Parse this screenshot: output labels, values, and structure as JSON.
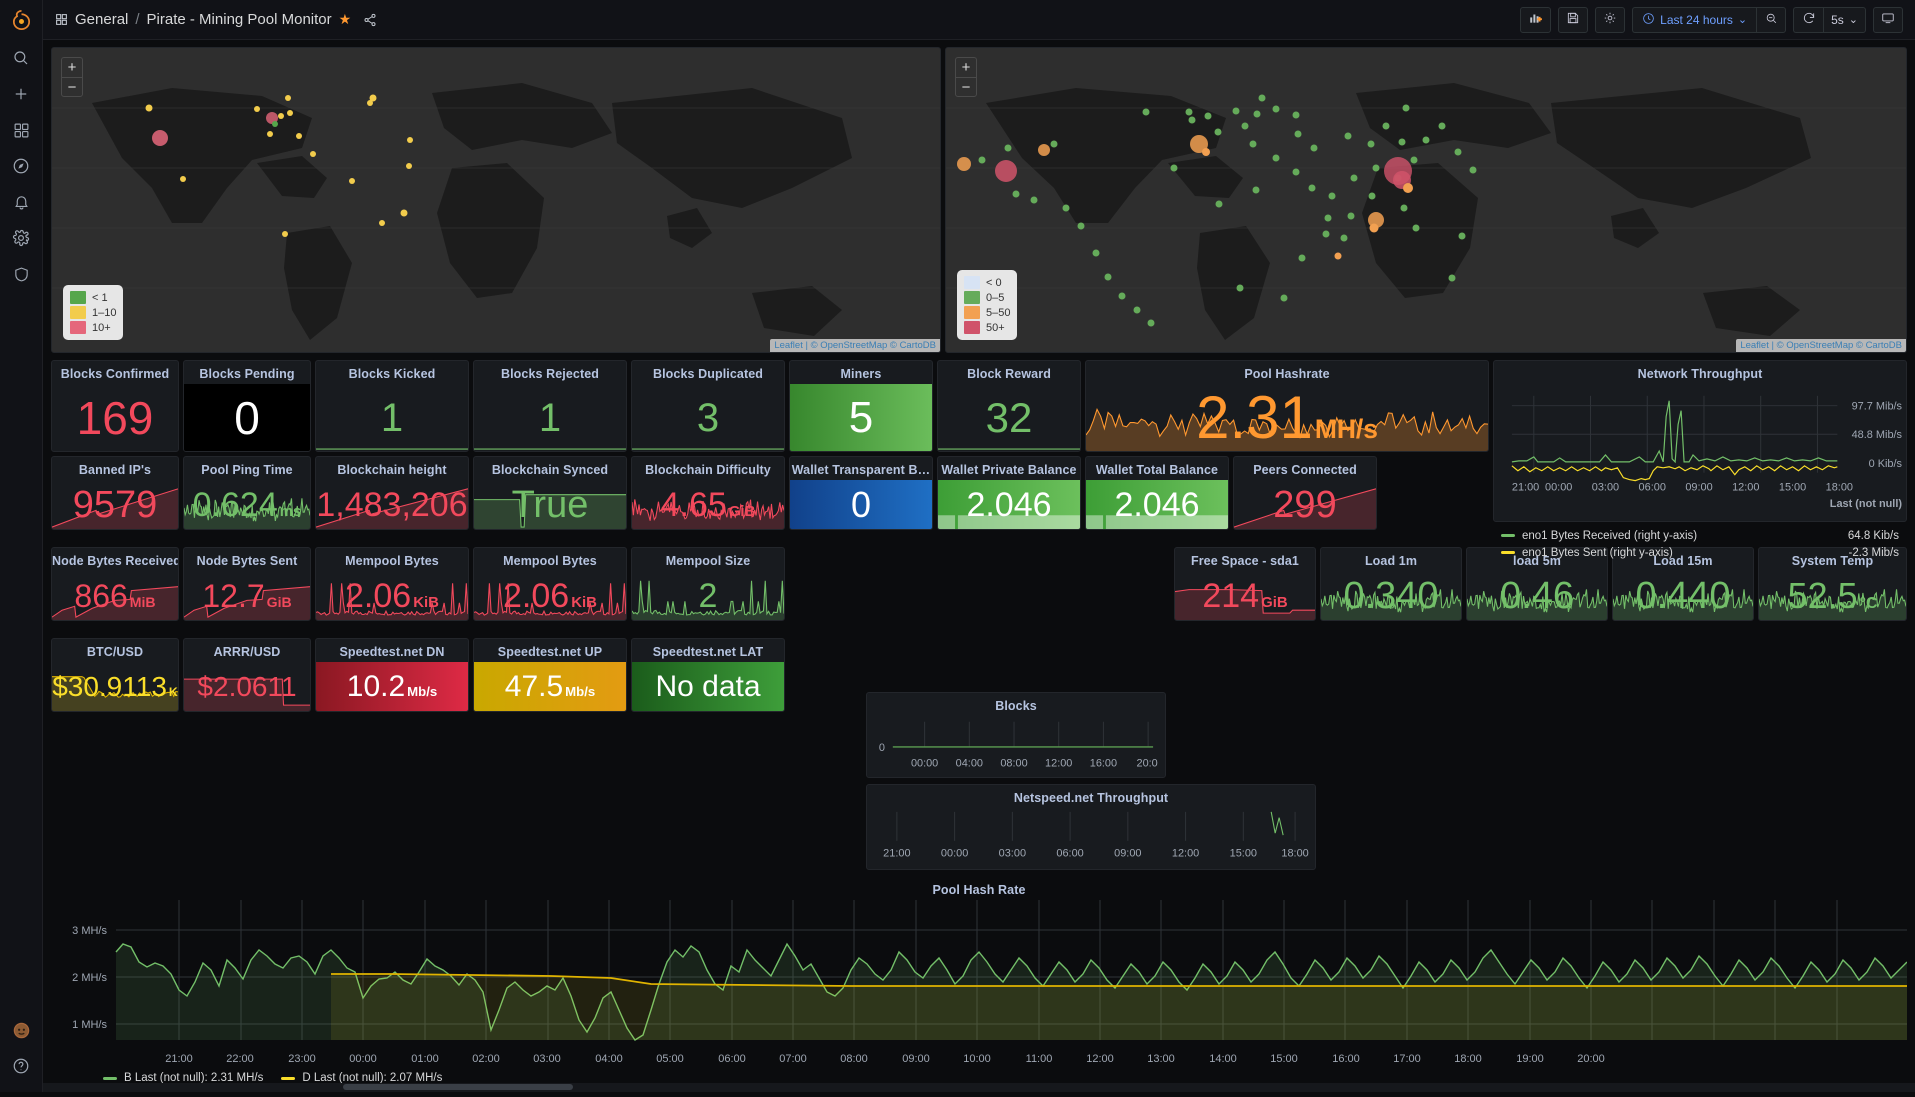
{
  "app": {
    "logo": "grafana-logo"
  },
  "sidebar": {
    "items": [
      {
        "name": "search-icon",
        "label": "Search"
      },
      {
        "name": "plus-icon",
        "label": "Create"
      },
      {
        "name": "dashboards-icon",
        "label": "Dashboards"
      },
      {
        "name": "explore-icon",
        "label": "Explore"
      },
      {
        "name": "bell-icon",
        "label": "Alerting"
      },
      {
        "name": "gear-icon",
        "label": "Configuration"
      },
      {
        "name": "shield-icon",
        "label": "Server Admin"
      }
    ],
    "bottom": [
      {
        "name": "user-avatar-icon",
        "label": "Profile"
      },
      {
        "name": "help-icon",
        "label": "Help"
      }
    ]
  },
  "header": {
    "folder": "General",
    "separator": "/",
    "title": "Pirate - Mining Pool Monitor",
    "star_icon": "star-icon",
    "share_icon": "share-icon",
    "toolbar": {
      "add_panel": "add-panel-icon",
      "save": "save-icon",
      "settings": "settings-icon",
      "time_range": "Last 24 hours",
      "time_icon": "clock-icon",
      "chevron": "⌄",
      "zoom_out": "zoom-out-icon",
      "refresh": "refresh-icon",
      "refresh_interval": "5s",
      "tv_mode": "tv-icon"
    }
  },
  "maps": {
    "left": {
      "title": "",
      "legend": [
        {
          "color": "#56a64b",
          "label": "< 1"
        },
        {
          "color": "#f2cc4c",
          "label": "1–10"
        },
        {
          "color": "#e5677b",
          "label": "10+"
        }
      ],
      "attribution": "Leaflet | © OpenStreetMap © CartoDB",
      "zoom_in": "+",
      "zoom_out": "−"
    },
    "right": {
      "title": "",
      "legend": [
        {
          "color": "#d7e3f4",
          "label": "< 0"
        },
        {
          "color": "#65ab5a",
          "label": "0–5"
        },
        {
          "color": "#f2a051",
          "label": "5–50"
        },
        {
          "color": "#d0536a",
          "label": "50+"
        }
      ],
      "attribution": "Leaflet | © OpenStreetMap © CartoDB",
      "zoom_in": "+",
      "zoom_out": "−"
    }
  },
  "stats": [
    {
      "id": "blocks-confirmed",
      "title": "Blocks Confirmed",
      "value": "169",
      "unit": "",
      "color": "#f2495c",
      "mode": "value",
      "spark": "up-red"
    },
    {
      "id": "blocks-pending",
      "title": "Blocks Pending",
      "value": "0",
      "unit": "",
      "color": "#ffffff",
      "mode": "bg-black",
      "spark": "none"
    },
    {
      "id": "blocks-kicked",
      "title": "Blocks Kicked",
      "value": "1",
      "unit": "",
      "color": "#73bf69",
      "mode": "value",
      "spark": "flat-green"
    },
    {
      "id": "blocks-rejected",
      "title": "Blocks Rejected",
      "value": "1",
      "unit": "",
      "color": "#73bf69",
      "mode": "value",
      "spark": "flat-green"
    },
    {
      "id": "blocks-duplicated",
      "title": "Blocks Duplicated",
      "value": "3",
      "unit": "",
      "color": "#73bf69",
      "mode": "value",
      "spark": "flat-green"
    },
    {
      "id": "miners",
      "title": "Miners",
      "value": "5",
      "unit": "",
      "color": "#ffffff",
      "mode": "bg-green",
      "spark": "none"
    },
    {
      "id": "block-reward",
      "title": "Block Reward",
      "value": "32",
      "unit": "",
      "color": "#73bf69",
      "mode": "value",
      "spark": "flat-green"
    },
    {
      "id": "pool-hashrate",
      "title": "Pool Hashrate",
      "value": "2.31",
      "unit": "MH/s",
      "color": "#ff9830",
      "mode": "value",
      "spark": "noisy-orange"
    },
    {
      "id": "banned-ips",
      "title": "Banned IP's",
      "value": "9579",
      "unit": "",
      "color": "#f2495c",
      "mode": "value",
      "spark": "ramp-red"
    },
    {
      "id": "pool-ping-time",
      "title": "Pool Ping Time",
      "value": "0.624",
      "unit": "ms",
      "color": "#73bf69",
      "mode": "value",
      "spark": "noisy-green"
    },
    {
      "id": "blockchain-height",
      "title": "Blockchain height",
      "value": "1,483,206",
      "unit": "",
      "color": "#f2495c",
      "mode": "value",
      "spark": "ramp-red"
    },
    {
      "id": "blockchain-synced",
      "title": "Blockchain Synced",
      "value": "True",
      "unit": "",
      "color": "#73bf69",
      "mode": "value",
      "spark": "step-green"
    },
    {
      "id": "blockchain-difficulty",
      "title": "Blockchain Difficulty",
      "value": "4.65",
      "unit": "GiB",
      "color": "#f2495c",
      "mode": "value",
      "spark": "noisy-red"
    },
    {
      "id": "wallet-transparent-balance",
      "title": "Wallet Transparent B…",
      "value": "0",
      "unit": "",
      "color": "#ffffff",
      "mode": "bg-blue",
      "spark": "none"
    },
    {
      "id": "wallet-private-balance",
      "title": "Wallet Private Balance",
      "value": "2.046",
      "unit": "",
      "color": "#ffffff",
      "mode": "bg-green2",
      "spark": "bars"
    },
    {
      "id": "wallet-total-balance",
      "title": "Wallet Total Balance",
      "value": "2.046",
      "unit": "",
      "color": "#ffffff",
      "mode": "bg-green2",
      "spark": "bars"
    },
    {
      "id": "peers-connected",
      "title": "Peers Connected",
      "value": "299",
      "unit": "",
      "color": "#f2495c",
      "mode": "value",
      "spark": "ramp-red"
    },
    {
      "id": "node-bytes-received",
      "title": "Node Bytes Received",
      "value": "866",
      "unit": "MiB",
      "color": "#f2495c",
      "mode": "value",
      "spark": "stair-red"
    },
    {
      "id": "node-bytes-sent",
      "title": "Node Bytes Sent",
      "value": "12.7",
      "unit": "GiB",
      "color": "#f2495c",
      "mode": "value",
      "spark": "stair-red"
    },
    {
      "id": "mempool-bytes-1",
      "title": "Mempool Bytes",
      "value": "2.06",
      "unit": "KiB",
      "color": "#f2495c",
      "mode": "value",
      "spark": "spike-red"
    },
    {
      "id": "mempool-bytes-2",
      "title": "Mempool Bytes",
      "value": "2.06",
      "unit": "KiB",
      "color": "#f2495c",
      "mode": "value",
      "spark": "spike-red"
    },
    {
      "id": "mempool-size",
      "title": "Mempool Size",
      "value": "2",
      "unit": "",
      "color": "#73bf69",
      "mode": "value",
      "spark": "spike-green"
    },
    {
      "id": "free-space-sda1",
      "title": "Free Space - sda1",
      "value": "214",
      "unit": "GiB",
      "color": "#f2495c",
      "mode": "value",
      "spark": "drop-red"
    },
    {
      "id": "load-1m",
      "title": "Load 1m",
      "value": "0.340",
      "unit": "",
      "color": "#73bf69",
      "mode": "value",
      "spark": "noisy-green"
    },
    {
      "id": "load-5m",
      "title": "load 5m",
      "value": "0.46",
      "unit": "",
      "color": "#73bf69",
      "mode": "value",
      "spark": "noisy-green"
    },
    {
      "id": "load-15m",
      "title": "Load 15m",
      "value": "0.440",
      "unit": "",
      "color": "#73bf69",
      "mode": "value",
      "spark": "noisy-green"
    },
    {
      "id": "system-temp",
      "title": "System Temp",
      "value": "52.5",
      "unit": "°C",
      "color": "#73bf69",
      "mode": "value",
      "spark": "noisy-green"
    },
    {
      "id": "btc-usd",
      "title": "BTC/USD",
      "value": "$30.9113",
      "unit": "K",
      "color": "#fade2a",
      "mode": "value",
      "spark": "dip-yellow"
    },
    {
      "id": "arrr-usd",
      "title": "ARRR/USD",
      "value": "$2.0611",
      "unit": "",
      "color": "#f2495c",
      "mode": "value",
      "spark": "step-red"
    },
    {
      "id": "speedtest-dn",
      "title": "Speedtest.net DN",
      "value": "10.2",
      "unit": "Mb/s",
      "color": "#ffffff",
      "mode": "bg-red",
      "spark": "none"
    },
    {
      "id": "speedtest-up",
      "title": "Speedtest.net UP",
      "value": "47.5",
      "unit": "Mb/s",
      "color": "#ffffff",
      "mode": "bg-yellow",
      "spark": "none"
    },
    {
      "id": "speedtest-lat",
      "title": "Speedtest.net LAT",
      "value": "No data",
      "unit": "",
      "color": "#ffffff",
      "mode": "bg-darkgreen",
      "spark": "none"
    }
  ],
  "network_throughput": {
    "title": "Network Throughput",
    "chart_data": {
      "type": "line",
      "title": "Network Throughput",
      "xlabel": "",
      "ylabel": "",
      "x_ticks": [
        "21:00",
        "00:00",
        "03:00",
        "06:00",
        "09:00",
        "12:00",
        "15:00",
        "18:00"
      ],
      "y_ticks": [
        "97.7 Mib/s",
        "48.8 Mib/s",
        "0 Kib/s"
      ],
      "ylim": [
        -10,
        100
      ],
      "grid": true,
      "legend_position": "bottom",
      "legend_header": "Last (not null)",
      "series": [
        {
          "name": "eno1 Bytes Received (right y-axis)",
          "color": "#73bf69",
          "last": "64.8 Kib/s"
        },
        {
          "name": "eno1 Bytes Sent (right y-axis)",
          "color": "#fade2a",
          "last": "-2.3 Mib/s"
        }
      ]
    }
  },
  "blocks_panel": {
    "title": "Blocks",
    "chart_data": {
      "type": "line",
      "title": "Blocks",
      "x_ticks": [
        "00:00",
        "04:00",
        "08:00",
        "12:00",
        "16:00",
        "20:0"
      ],
      "y_ticks": [
        "0"
      ],
      "grid": true,
      "series": [
        {
          "name": "Blocks",
          "color": "#73bf69",
          "values_flat": 0
        }
      ]
    }
  },
  "netspeed_panel": {
    "title": "Netspeed.net Throughput",
    "chart_data": {
      "type": "line",
      "title": "Netspeed.net Throughput",
      "x_ticks": [
        "21:00",
        "00:00",
        "03:00",
        "06:00",
        "09:00",
        "12:00",
        "15:00",
        "18:00"
      ],
      "grid": true,
      "series": [
        {
          "name": "Netspeed",
          "color": "#73bf69"
        }
      ]
    }
  },
  "pool_hash_rate": {
    "title": "Pool Hash Rate",
    "chart_data": {
      "type": "line",
      "title": "Pool Hash Rate",
      "xlabel": "",
      "ylabel": "",
      "y_ticks": [
        "3 MH/s",
        "2 MH/s",
        "1 MH/s"
      ],
      "ylim": [
        0,
        3.4
      ],
      "x_ticks": [
        "21:00",
        "22:00",
        "23:00",
        "00:00",
        "01:00",
        "02:00",
        "03:00",
        "04:00",
        "05:00",
        "06:00",
        "07:00",
        "08:00",
        "09:00",
        "10:00",
        "11:00",
        "12:00",
        "13:00",
        "14:00",
        "15:00",
        "16:00",
        "17:00",
        "18:00",
        "19:00",
        "20:00"
      ],
      "grid": true,
      "legend_position": "bottom",
      "series": [
        {
          "name": "B",
          "color": "#73bf69",
          "legend_text": "B  Last (not null): 2.31 MH/s",
          "last": "2.31 MH/s"
        },
        {
          "name": "D",
          "color": "#fade2a",
          "legend_text": "D  Last (not null): 2.07 MH/s",
          "last": "2.07 MH/s"
        }
      ]
    }
  }
}
